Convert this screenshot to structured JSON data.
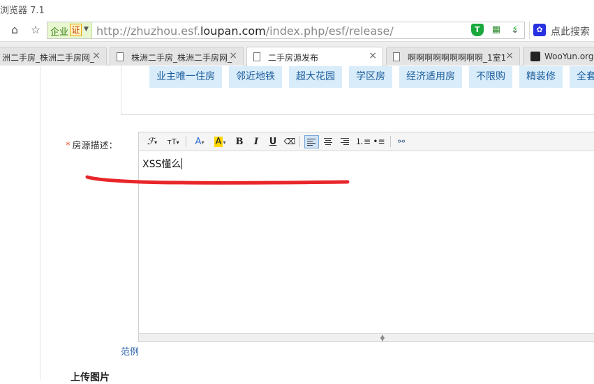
{
  "window": {
    "title": "浏览器 7.1"
  },
  "navbar": {
    "badge": {
      "label": "企业",
      "cert": "证"
    },
    "url": {
      "prefix": "http://zhuzhou.esf.",
      "domain": "loupan.com",
      "path": "/index.php/esf/release/"
    },
    "search_placeholder": "点此搜索",
    "icons": [
      "home-icon",
      "star-icon",
      "shield-icon",
      "qr-icon",
      "bolt-icon",
      "chevron-down-icon",
      "paw-icon"
    ]
  },
  "tabs": [
    {
      "label": "洲二手房_株洲二手房网_",
      "active": false
    },
    {
      "label": "株洲二手房_株洲二手房网_",
      "active": false
    },
    {
      "label": "二手房源发布",
      "active": true
    },
    {
      "label": "啊啊啊啊啊啊啊啊啊_1室1",
      "active": false
    },
    {
      "label": "WooYun.org",
      "active": false
    }
  ],
  "tags": [
    "业主唯一住房",
    "邻近地铁",
    "超大花园",
    "学区房",
    "经济适用房",
    "不限购",
    "精装修",
    "全套"
  ],
  "form": {
    "description_label": "房源描述：",
    "required_mark": "*",
    "editor_text": "XSS懂么",
    "example_link": "范例",
    "upload_title": "上传图片"
  },
  "toolbar": {
    "font_family": "ℱ",
    "font_size": "тT",
    "font_color": "A",
    "highlight": "A",
    "bold": "B",
    "italic": "I",
    "underline": "U",
    "active_alignment": "left"
  },
  "colors": {
    "tag_bg": "#d9ecfa",
    "tag_text": "#1c5d9b",
    "annotation": "#e8262a",
    "link": "#2b63a8"
  }
}
